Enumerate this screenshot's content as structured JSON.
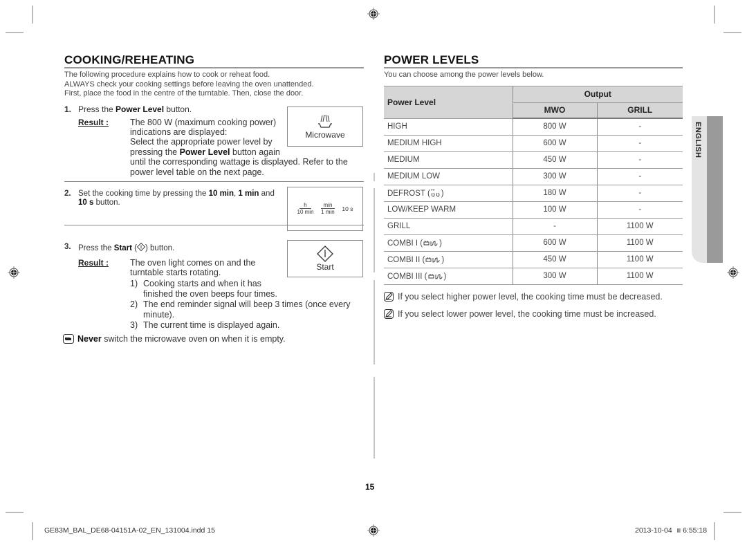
{
  "cooking": {
    "title": "COOKING/REHEATING",
    "intro": [
      "The following procedure explains how to cook or reheat food.",
      "ALWAYS check your cooking settings before leaving the oven unattended.",
      "First, place the food in the centre of the turntable. Then, close the door."
    ],
    "step1": {
      "num": "1.",
      "pre": "Press the ",
      "bold": "Power Level",
      "post": " button.",
      "result_label": "Result :",
      "result_lines": [
        "The 800 W (maximum cooking power)",
        "indications are displayed:",
        "Select the appropriate power level by"
      ],
      "result_line4_pre": "pressing the ",
      "result_line4_bold": "Power Level",
      "result_line4_post": " button again",
      "result_line5": "until the corresponding wattage is displayed. Refer to the",
      "result_line6": "power level table on the next page.",
      "panel_icon": "microwave-icon",
      "panel_label": "Microwave"
    },
    "step2": {
      "num": "2.",
      "pre": "Set the cooking time by pressing the ",
      "bold1": "10 min",
      "mid1": ", ",
      "bold2": "1 min",
      "mid2": " and",
      "bold3": "10 s",
      "post": " button.",
      "panel": {
        "h_top": "h",
        "h_bottom": "10 min",
        "min_top": "min",
        "min_bottom": "1 min",
        "sec": "10 s"
      }
    },
    "step3": {
      "num": "3.",
      "pre": "Press the ",
      "bold": "Start",
      "post_icon": "start-icon",
      "post": ") button.",
      "open_paren": " (",
      "result_label": "Result :",
      "result_lines": [
        "The oven light comes on and the",
        "turntable starts rotating."
      ],
      "sub_items": [
        {
          "n": "1)",
          "text": "Cooking starts and when it has",
          "text2": "finished the oven beeps four times."
        },
        {
          "n": "2)",
          "text": "The end reminder signal will beep 3 times (once every",
          "text2": "minute)."
        },
        {
          "n": "3)",
          "text": "The current time is displayed again.",
          "text2": ""
        }
      ],
      "panel_label": "Start"
    },
    "warning": {
      "icon": "pointing-hand-icon",
      "bold": "Never",
      "text": " switch the microwave oven on when it is empty."
    }
  },
  "power_levels": {
    "title": "POWER LEVELS",
    "intro": "You can choose among the power levels below.",
    "headers": {
      "level": "Power Level",
      "output": "Output",
      "mwo": "MWO",
      "grill": "GRILL"
    },
    "rows": [
      {
        "level": "HIGH",
        "mwo": "800 W",
        "grill": "-"
      },
      {
        "level": "MEDIUM HIGH",
        "mwo": "600 W",
        "grill": "-"
      },
      {
        "level": "MEDIUM",
        "mwo": "450 W",
        "grill": "-"
      },
      {
        "level": "MEDIUM LOW",
        "mwo": "300 W",
        "grill": "-"
      },
      {
        "level": "DEFROST",
        "icon": "defrost-icon",
        "mwo": "180 W",
        "grill": "-"
      },
      {
        "level": "LOW/KEEP WARM",
        "mwo": "100 W",
        "grill": "-"
      },
      {
        "level": "GRILL",
        "mwo": "-",
        "grill": "1100 W"
      },
      {
        "level": "COMBI I",
        "icon": "combi-icon",
        "mwo": "600 W",
        "grill": "1100 W"
      },
      {
        "level": "COMBI II",
        "icon": "combi-icon",
        "mwo": "450 W",
        "grill": "1100 W"
      },
      {
        "level": "COMBI III",
        "icon": "combi-icon",
        "mwo": "300 W",
        "grill": "1100 W"
      }
    ],
    "notes": [
      "If you select higher power level, the cooking time must be decreased.",
      "If you select lower power level, the cooking time must be increased."
    ]
  },
  "side_tab": {
    "language": "ENGLISH"
  },
  "page_number": "15",
  "footer": {
    "file": "GE83M_BAL_DE68-04151A-02_EN_131004.indd   15",
    "date": "2013-10-04",
    "time": "6:55:18",
    "time_glyph": "Ⅲ"
  },
  "colors": {
    "table_header_bg": "#d6d6d6",
    "side_tab_light": "#e4e4e4",
    "side_tab_dark": "#9a9a9a"
  }
}
